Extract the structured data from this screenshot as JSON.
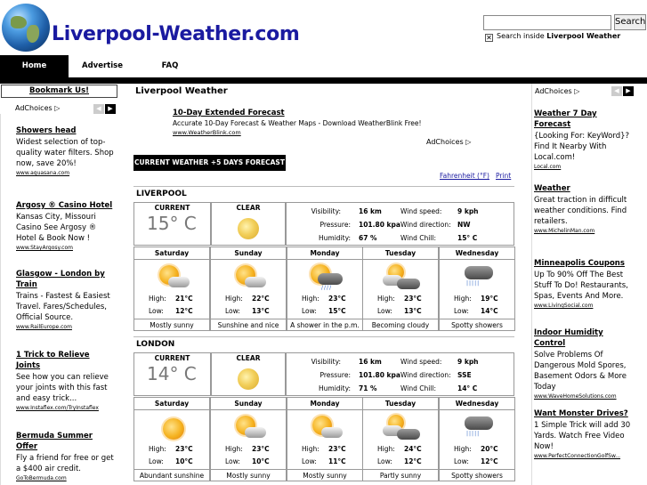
{
  "header": {
    "site_title": "Liverpool-Weather.com",
    "search_button": "Search",
    "search_inside_prefix": "Search inside",
    "search_inside_site": "Liverpool Weather"
  },
  "nav": {
    "home": "Home",
    "advertise": "Advertise",
    "faq": "FAQ"
  },
  "left": {
    "bookmark": "Bookmark Us!",
    "adchoices": "AdChoices",
    "ads": [
      {
        "title": "Showers head",
        "desc": "Widest selection of top-quality water filters. Shop now, save 20%!",
        "url": "www.aquasana.com"
      },
      {
        "title": "Argosy ® Casino Hotel",
        "desc": "Kansas City, Missouri Casino See Argosy ® Hotel & Book Now !",
        "url": "www.StayArgosy.com"
      },
      {
        "title": "Glasgow - London by Train",
        "desc": "Trains - Fastest & Easiest Travel. Fares/Schedules, Official Source.",
        "url": "www.RailEurope.com"
      },
      {
        "title": "1 Trick to Relieve Joints",
        "desc": "See how you can relieve your joints with this fast and easy trick...",
        "url": "www.Instaflex.com/TryInstaflex"
      },
      {
        "title": "Bermuda Summer Offer",
        "desc": "Fly a friend for free or get a $400 air credit.",
        "url": "GoToBermuda.com"
      }
    ]
  },
  "main": {
    "title": "Liverpool Weather",
    "promo": {
      "title": "10-Day Extended Forecast",
      "desc": "Accurate 10-Day Forecast & Weather Maps - Download WeatherBlink Free!",
      "url": "www.WeatherBlink.com",
      "adchoices": "AdChoices"
    },
    "bar": "CURRENT WEATHER +5 DAYS FORECAST",
    "fahrenheit": "Fahrenheit (°F)",
    "print": "Print",
    "labels": {
      "current": "CURRENT",
      "visibility": "Visibility:",
      "pressure": "Pressure:",
      "humidity": "Humidity:",
      "wind_speed": "Wind speed:",
      "wind_direction": "Wind direction:",
      "wind_chill": "Wind Chill:",
      "high": "High:",
      "low": "Low:"
    },
    "cities": [
      {
        "name": "LIVERPOOL",
        "temp": "15° C",
        "condition": "CLEAR",
        "visibility": "16 km",
        "pressure": "101.80 kpa",
        "humidity": "67 %",
        "wind_speed": "9 kph",
        "wind_direction": "NW",
        "wind_chill": "15° C",
        "days": [
          {
            "name": "Saturday",
            "icon": "sun-cloud-icon",
            "high": "21°C",
            "low": "12°C",
            "desc": "Mostly sunny"
          },
          {
            "name": "Sunday",
            "icon": "sun-cloud-icon",
            "high": "22°C",
            "low": "13°C",
            "desc": "Sunshine and nice"
          },
          {
            "name": "Monday",
            "icon": "sun-rain-icon",
            "high": "23°C",
            "low": "15°C",
            "desc": "A shower in the p.m."
          },
          {
            "name": "Tuesday",
            "icon": "sun-clouds-icon",
            "high": "23°C",
            "low": "13°C",
            "desc": "Becoming cloudy"
          },
          {
            "name": "Wednesday",
            "icon": "rain-cloud-icon",
            "high": "19°C",
            "low": "14°C",
            "desc": "Spotty showers"
          }
        ]
      },
      {
        "name": "LONDON",
        "temp": "14° C",
        "condition": "CLEAR",
        "visibility": "16 km",
        "pressure": "101.80 kpa",
        "humidity": "71 %",
        "wind_speed": "9 kph",
        "wind_direction": "SSE",
        "wind_chill": "14° C",
        "days": [
          {
            "name": "Saturday",
            "icon": "sun-icon",
            "high": "23°C",
            "low": "10°C",
            "desc": "Abundant sunshine"
          },
          {
            "name": "Sunday",
            "icon": "sun-cloud-icon",
            "high": "23°C",
            "low": "10°C",
            "desc": "Mostly sunny"
          },
          {
            "name": "Monday",
            "icon": "sun-cloud-icon",
            "high": "23°C",
            "low": "11°C",
            "desc": "Mostly sunny"
          },
          {
            "name": "Tuesday",
            "icon": "sun-clouds-icon",
            "high": "24°C",
            "low": "12°C",
            "desc": "Partly sunny"
          },
          {
            "name": "Wednesday",
            "icon": "rain-cloud-icon",
            "high": "20°C",
            "low": "12°C",
            "desc": "Spotty showers"
          }
        ]
      }
    ]
  },
  "right": {
    "adchoices": "AdChoices",
    "ads": [
      {
        "title": "Weather 7 Day Forecast",
        "desc": "{Looking For: KeyWord}? Find It Nearby With Local.com!",
        "url": "Local.com"
      },
      {
        "title": "Weather",
        "desc": "Great traction in difficult weather conditions. Find retailers.",
        "url": "www.MichelinMan.com"
      },
      {
        "title": "Minneapolis Coupons",
        "desc": "Up To 90% Off The Best Stuff To Do! Restaurants, Spas, Events And More.",
        "url": "www.LivingSocial.com"
      },
      {
        "title": "Indoor Humidity Control",
        "desc": "Solve Problems Of Dangerous Mold Spores, Basement Odors & More Today",
        "url": "www.WaveHomeSolutions.com"
      },
      {
        "title": "Want Monster Drives?",
        "desc": "1 Simple Trick will add 30 Yards. Watch Free Video Now!",
        "url": "www.PerfectConnectionGolfSw..."
      }
    ]
  }
}
